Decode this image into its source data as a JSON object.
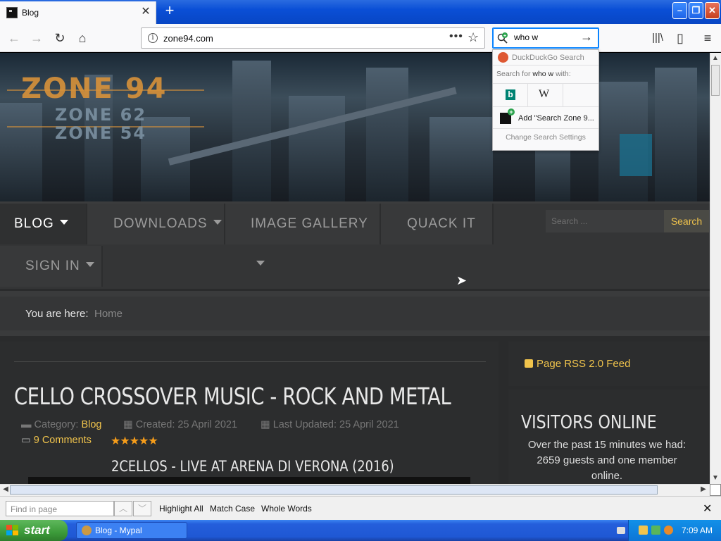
{
  "browser": {
    "tab_title": "Blog",
    "url": "zone94.com",
    "search_query": "who w",
    "page_actions": "•••"
  },
  "search_dropdown": {
    "engine_name": "DuckDuckGo Search",
    "search_for_prefix": "Search for",
    "search_for_query": "who w",
    "search_for_suffix": "with:",
    "engines": [
      "Bing",
      "Wikipedia"
    ],
    "add_label": "Add \"Search Zone 9...",
    "change_settings": "Change Search Settings"
  },
  "site": {
    "logo_main": "ZONE 94",
    "logo_sub1": "ZONE 62",
    "logo_sub2": "ZONE 54",
    "menu": [
      {
        "label": "BLOG",
        "dropdown": true
      },
      {
        "label": "DOWNLOADS",
        "dropdown": true
      },
      {
        "label": "IMAGE GALLERY",
        "dropdown": true
      },
      {
        "label": "QUACK IT",
        "dropdown": false
      },
      {
        "label": "SIGN IN",
        "dropdown": true
      }
    ],
    "search_placeholder": "Search ...",
    "search_button": "Search",
    "breadcrumb_prefix": "You are here:",
    "breadcrumb_home": "Home"
  },
  "article": {
    "title": "CELLO CROSSOVER MUSIC - ROCK AND METAL",
    "category_label": "Category:",
    "category": "Blog",
    "created": "Created: 25 April 2021",
    "updated": "Last Updated: 25 April 2021",
    "comments": "9 Comments",
    "rating_stars": 5,
    "stars": "★★★★★",
    "subtitle": "2CELLOS - LIVE AT ARENA DI VERONA (2016)"
  },
  "sidebar": {
    "rss": "Page RSS 2.0 Feed",
    "visitors_title": "VISITORS ONLINE",
    "visitors_text": "Over the past 15 minutes we had: 2659 guests and one member online."
  },
  "findbar": {
    "placeholder": "Find in page",
    "highlight_all": "Highlight All",
    "match_case": "Match Case",
    "whole_words": "Whole Words"
  },
  "taskbar": {
    "start": "start",
    "task": "Blog - Mypal",
    "clock": "7:09 AM"
  },
  "colors": {
    "accent": "#f1c44c",
    "stars": "#f59c1a",
    "titlebar": "#0a4fd6"
  }
}
